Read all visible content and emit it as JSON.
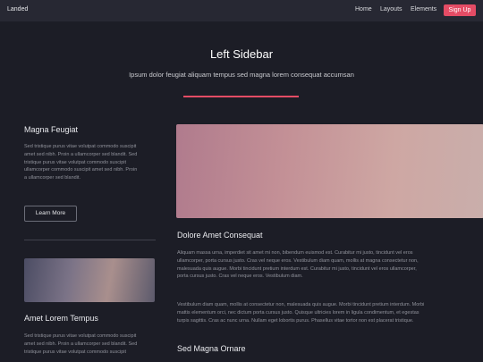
{
  "header": {
    "logo": "Landed",
    "nav": [
      "Home",
      "Layouts",
      "Elements"
    ],
    "signup": "Sign Up",
    "accent": "#e44c65"
  },
  "hero": {
    "title": "Left Sidebar",
    "subtitle": "Ipsum dolor feugiat aliquam tempus sed magna lorem consequat accumsan"
  },
  "sidebar": {
    "section1": {
      "heading": "Magna Feugiat",
      "lines": [
        "Sed tristique purus vitae volutpat commodo suscipit",
        "amet sed nibh. Proin a ullamcorper sed blandit. Sed",
        "tristique purus vitae volutpat commodo suscipit",
        "ullamcorper commodo suscipit amet sed nibh. Proin",
        "a ullamcorper sed blandit."
      ],
      "button": "Learn More"
    },
    "section2": {
      "heading": "Amet Lorem Tempus",
      "lines": [
        "Sed tristique purus vitae volutpat commodo suscipit",
        "amet sed nibh. Proin a ullamcorper sed blandit. Sed",
        "tristique purus vitae volutpat commodo suscipit"
      ]
    }
  },
  "main": {
    "heading1": "Dolore Amet Consequat",
    "para1": [
      "Aliquam massa urna, imperdiet sit amet mi non, bibendum euismod est. Curabitur mi justo, tincidunt vel eros",
      "ullamcorper, porta cursus justo. Cras vel neque eros. Vestibulum diam quam, mollis at magna consectetur non,",
      "malesuada quis augue. Morbi tincidunt pretium interdum est. Curabitur mi justo, tincidunt vel eros ullamcorper,",
      "porta cursus justo. Cras vel neque eros. Vestibulum diam."
    ],
    "para2": [
      "Vestibulum diam quam, mollis at consectetur non, malesuada quis augue. Morbi tincidunt pretium interdum. Morbi",
      "mattis elementum orci, nec dictum porta cursus justo. Quisque ultricies lorem in ligula condimentum, et egestas",
      "turpis sagittis. Cras ac nunc urna. Nullam eget lobortis purus. Phasellus vitae tortor non est placerat tristique."
    ],
    "heading2": "Sed Magna Ornare"
  }
}
